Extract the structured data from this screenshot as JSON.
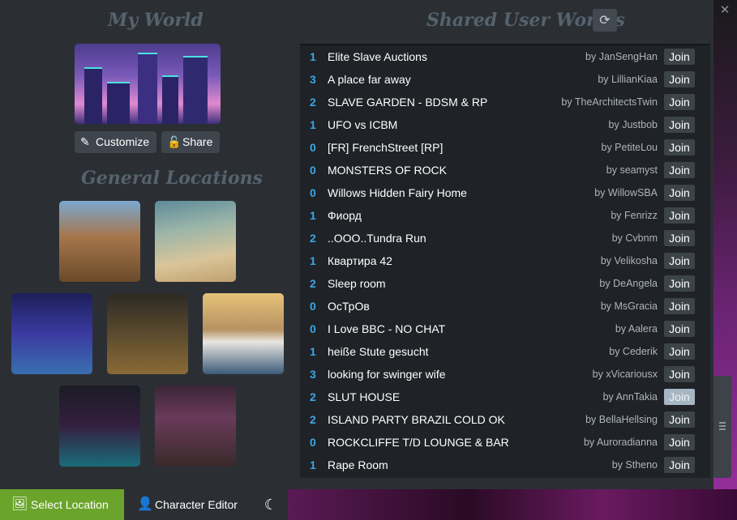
{
  "headings": {
    "my_world": "My World",
    "general_locations": "General Locations",
    "shared_user_worlds": "Shared User Worlds"
  },
  "icons": {
    "refresh": "refresh-icon",
    "close": "close-icon",
    "customize": "brush-icon",
    "share": "unlock-icon",
    "select_location": "image-icon",
    "character_editor": "person-icon",
    "night_mode": "moon-icon"
  },
  "my_world": {
    "customize_label": "Customize",
    "share_label": "Share"
  },
  "worlds": [
    {
      "count": "1",
      "name": "Elite Slave Auctions",
      "by": "by  JanSengHan",
      "join": "Join"
    },
    {
      "count": "3",
      "name": "A place far away",
      "by": "by  LillianKiaa",
      "join": "Join"
    },
    {
      "count": "2",
      "name": "SLAVE GARDEN - BDSM & RP",
      "by": "by  TheArchitectsTwin",
      "join": "Join"
    },
    {
      "count": "1",
      "name": "UFO vs ICBM",
      "by": "by  Justbob",
      "join": "Join"
    },
    {
      "count": "0",
      "name": "[FR] FrenchStreet [RP]",
      "by": "by  PetiteLou",
      "join": "Join"
    },
    {
      "count": "0",
      "name": "MONSTERS OF ROCK",
      "by": "by  seamyst",
      "join": "Join"
    },
    {
      "count": "0",
      "name": "Willows Hidden Fairy Home",
      "by": "by  WillowSBA",
      "join": "Join"
    },
    {
      "count": "1",
      "name": "Фиорд",
      "by": "by  Fenrizz",
      "join": "Join"
    },
    {
      "count": "2",
      "name": "..OOO..Tundra Run",
      "by": "by  Cvbnm",
      "join": "Join"
    },
    {
      "count": "1",
      "name": "Квартира 42",
      "by": "by  Velikosha",
      "join": "Join"
    },
    {
      "count": "2",
      "name": "Sleep room",
      "by": "by  DeAngela",
      "join": "Join"
    },
    {
      "count": "0",
      "name": "ОсТрОв",
      "by": "by  MsGracia",
      "join": "Join"
    },
    {
      "count": "0",
      "name": "I Love BBC - NO CHAT",
      "by": "by  Aalera",
      "join": "Join"
    },
    {
      "count": "1",
      "name": "heiße Stute gesucht",
      "by": "by  Cederik",
      "join": "Join"
    },
    {
      "count": "3",
      "name": "looking for swinger wife",
      "by": "by  xVicariousx",
      "join": "Join"
    },
    {
      "count": "2",
      "name": "SLUT HOUSE",
      "by": "by  AnnTakia",
      "join": "Join"
    },
    {
      "count": "2",
      "name": "ISLAND PARTY BRAZIL COLD OK",
      "by": "by  BellaHellsing",
      "join": "Join"
    },
    {
      "count": "0",
      "name": "ROCKCLIFFE T/D LOUNGE & BAR",
      "by": "by  Auroradianna",
      "join": "Join"
    },
    {
      "count": "1",
      "name": "Rape Room",
      "by": "by  Stheno",
      "join": "Join"
    }
  ],
  "bottom_bar": {
    "select_location": "Select Location",
    "character_editor": "Character Editor"
  }
}
